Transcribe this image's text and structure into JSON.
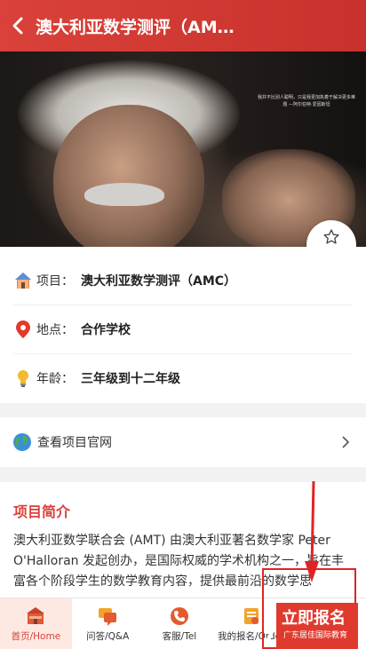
{
  "header": {
    "title": "澳大利亚数学测评（AM…"
  },
  "hero": {
    "quote": "我并不比别人聪明，只是我更加执着于解决更多难题 —阿尔伯特·爱因斯坦"
  },
  "favorite": {
    "label": "收藏",
    "icon": "star-icon"
  },
  "info": {
    "project": {
      "label": "项目：",
      "value": "澳大利亚数学测评（AMC）",
      "icon": "house-icon"
    },
    "location": {
      "label": "地点：",
      "value": "合作学校",
      "icon": "map-pin-icon"
    },
    "age": {
      "label": "年龄：",
      "value": "三年级到十二年级",
      "icon": "lightbulb-icon"
    }
  },
  "official_link": {
    "label": "查看项目官网",
    "icon": "globe-icon"
  },
  "intro": {
    "title": "项目简介",
    "body": "澳大利亚数学联合会 (AMT) 由澳大利亚著名数学家 Peter O'Halloran 发起创办，是国际权威的学术机构之一，旨在丰富各个阶段学生的数学教育内容，提供最前沿的数学思"
  },
  "tabbar": [
    {
      "label": "首页/Home",
      "icon": "home-icon"
    },
    {
      "label": "问答/Q&A",
      "icon": "chat-icon"
    },
    {
      "label": "客服/Tel",
      "icon": "phone-icon"
    },
    {
      "label": "我的报名/Order",
      "icon": "order-icon"
    }
  ],
  "promo": {
    "title": "立即报名",
    "subtitle": "广东居佳国际教育"
  },
  "colors": {
    "brand": "#d9413a",
    "accent_red": "#e02424"
  }
}
